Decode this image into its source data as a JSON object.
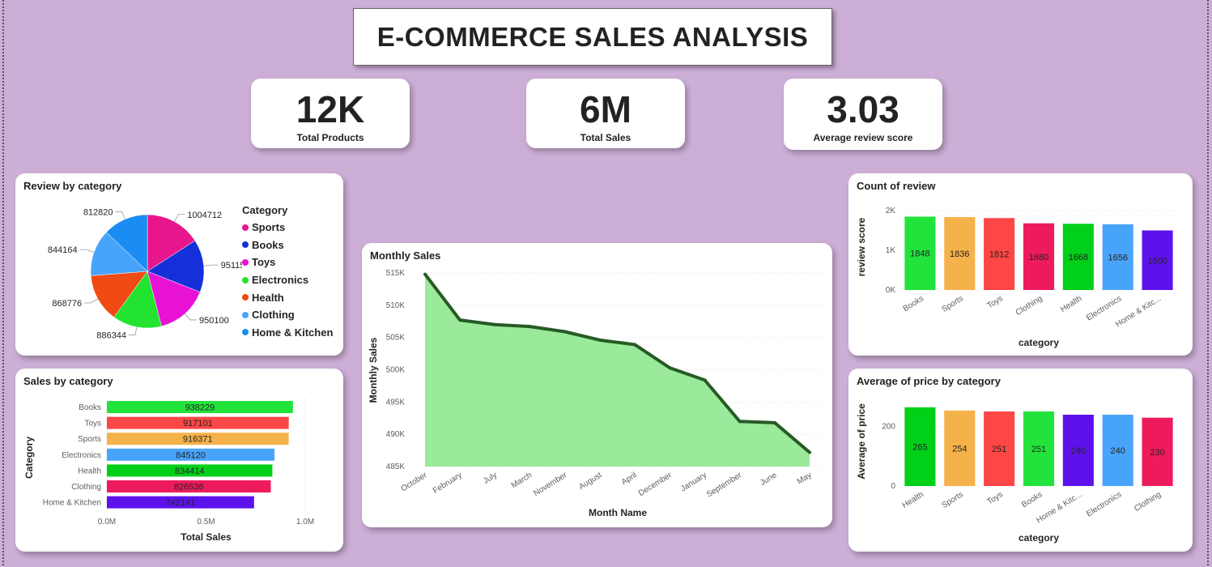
{
  "header": {
    "title": "E-COMMERCE SALES ANALYSIS"
  },
  "kpis": [
    {
      "value": "12K",
      "label": "Total Products"
    },
    {
      "value": "6M",
      "label": "Total Sales"
    },
    {
      "value": "3.03",
      "label": "Average review score"
    }
  ],
  "chart_data": [
    {
      "id": "review_by_category",
      "type": "pie",
      "title": "Review by category",
      "legend_title": "Category",
      "legend_position": "right",
      "slices": [
        {
          "label": "Sports",
          "value": 1004712,
          "color": "#e8168c"
        },
        {
          "label": "Books",
          "value": 951156,
          "color": "#1530d8"
        },
        {
          "label": "Toys",
          "value": 950100,
          "color": "#e812d5"
        },
        {
          "label": "Electronics",
          "value": 886344,
          "color": "#22e32f"
        },
        {
          "label": "Health",
          "value": 868776,
          "color": "#f04b12"
        },
        {
          "label": "Clothing",
          "value": 844164,
          "color": "#48a4fa"
        },
        {
          "label": "Home & Kitchen",
          "value": 812820,
          "color": "#1a8cf2"
        }
      ]
    },
    {
      "id": "sales_by_category",
      "type": "bar",
      "orientation": "horizontal",
      "title": "Sales by category",
      "xlabel": "Total Sales",
      "ylabel": "Category",
      "xlim": [
        0,
        1000000
      ],
      "xticks": [
        "0.0M",
        "0.5M",
        "1.0M"
      ],
      "categories": [
        "Books",
        "Toys",
        "Sports",
        "Electronics",
        "Health",
        "Clothing",
        "Home & Kitchen"
      ],
      "values": [
        938229,
        917101,
        916371,
        845120,
        834414,
        826536,
        742141
      ],
      "colors": [
        "#22e33c",
        "#fd4646",
        "#f5b14a",
        "#48a4fa",
        "#00d018",
        "#ee1b5c",
        "#5d12ec"
      ]
    },
    {
      "id": "monthly_sales",
      "type": "area",
      "title": "Monthly Sales",
      "xlabel": "Month Name",
      "ylabel": "Monthly Sales",
      "ylim": [
        485000,
        515000
      ],
      "yticks": [
        "485K",
        "490K",
        "495K",
        "500K",
        "505K",
        "510K",
        "515K"
      ],
      "categories": [
        "October",
        "February",
        "July",
        "March",
        "November",
        "August",
        "April",
        "December",
        "January",
        "September",
        "June",
        "May"
      ],
      "values": [
        514800,
        507700,
        507000,
        506700,
        505900,
        504600,
        503900,
        500300,
        498400,
        492000,
        491800,
        487200
      ],
      "line_color": "#265b25",
      "fill_color": "#9be99a",
      "grid": true
    },
    {
      "id": "count_of_review",
      "type": "bar",
      "orientation": "vertical",
      "title": "Count of review",
      "xlabel": "category",
      "ylabel": "review score",
      "ylim": [
        0,
        2000
      ],
      "yticks": [
        "0K",
        "1K",
        "2K"
      ],
      "categories": [
        "Books",
        "Sports",
        "Toys",
        "Clothing",
        "Health",
        "Electronics",
        "Home & Kitc..."
      ],
      "values": [
        1848,
        1836,
        1812,
        1680,
        1668,
        1656,
        1500
      ],
      "colors": [
        "#22e33c",
        "#f5b14a",
        "#fd4646",
        "#ee1b5c",
        "#00d018",
        "#48a4fa",
        "#5d12ec"
      ]
    },
    {
      "id": "avg_price_by_category",
      "type": "bar",
      "orientation": "vertical",
      "title": "Average of price by category",
      "xlabel": "category",
      "ylabel": "Average of price",
      "ylim": [
        0,
        300
      ],
      "yticks": [
        "0",
        "200"
      ],
      "categories": [
        "Health",
        "Sports",
        "Toys",
        "Books",
        "Home & Kitc...",
        "Electronics",
        "Clothing"
      ],
      "values": [
        265,
        254,
        251,
        251,
        240,
        240,
        230
      ],
      "colors": [
        "#00d018",
        "#f5b14a",
        "#fd4646",
        "#22e33c",
        "#5d12ec",
        "#48a4fa",
        "#ee1b5c"
      ]
    }
  ]
}
